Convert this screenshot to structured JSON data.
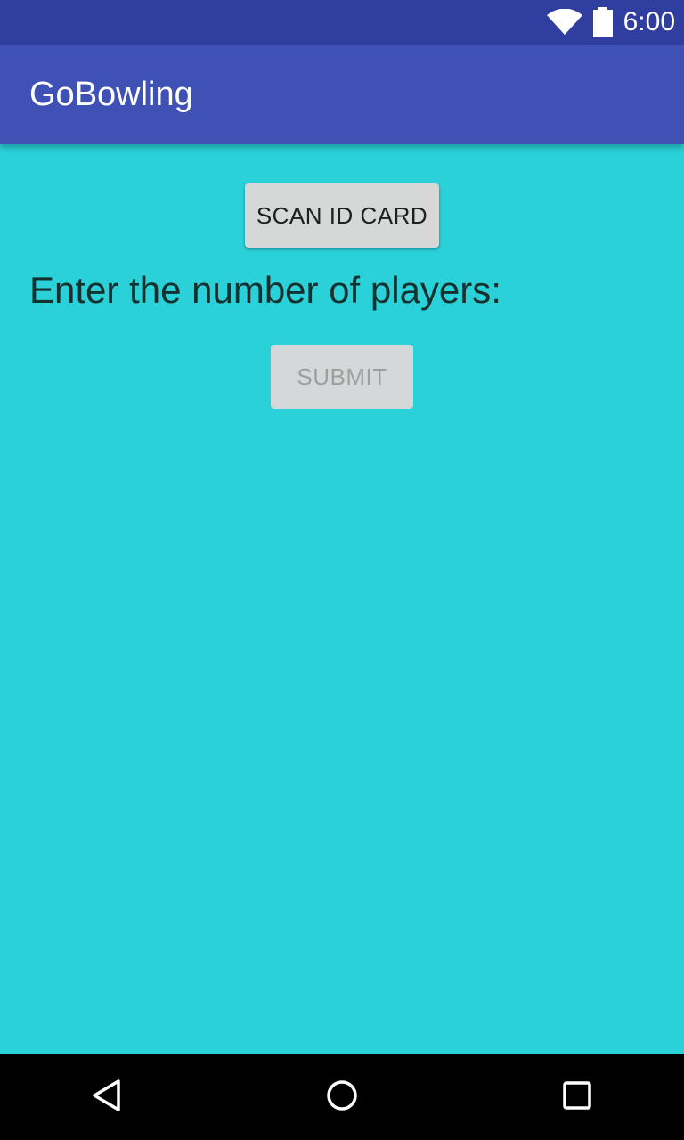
{
  "status_bar": {
    "time": "6:00",
    "icons": [
      "wifi-icon",
      "battery-icon"
    ]
  },
  "app_bar": {
    "title": "GoBowling"
  },
  "main": {
    "scan_button_label": "SCAN ID CARD",
    "players_prompt": "Enter the number of players:",
    "submit_button_label": "SUBMIT"
  },
  "nav_bar": {
    "icons": [
      "back-icon",
      "home-icon",
      "recents-icon"
    ]
  },
  "colors": {
    "status_bar": "#303F9F",
    "app_bar": "#3F51B5",
    "background": "#2AD1D8",
    "nav_bar": "#000000"
  }
}
